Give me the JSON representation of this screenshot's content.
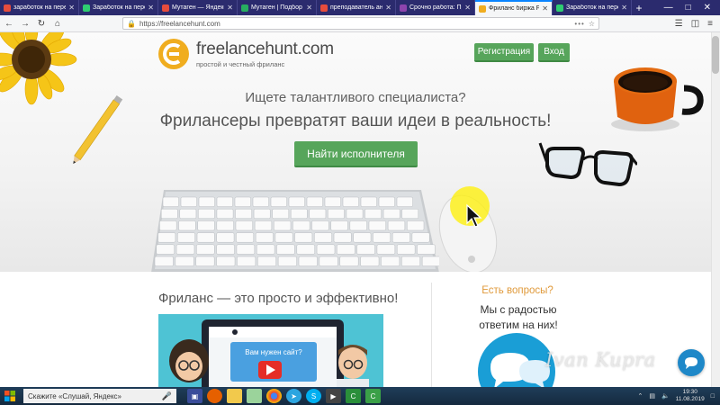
{
  "tabs": [
    {
      "title": "заработок на перев...",
      "favicon_color": "#e74c3c",
      "active": false
    },
    {
      "title": "Заработок на перево...",
      "favicon_color": "#2ecc71",
      "active": false
    },
    {
      "title": "Мутаген — Яндекс: н...",
      "favicon_color": "#e74c3c",
      "active": false
    },
    {
      "title": "Мутаген | Подбор кл...",
      "favicon_color": "#27ae60",
      "active": false
    },
    {
      "title": "преподаватель англ...",
      "favicon_color": "#e74c3c",
      "active": false
    },
    {
      "title": "Срочно работа: Про...",
      "favicon_color": "#8e44ad",
      "active": false
    },
    {
      "title": "Фриланс биржа Free...",
      "favicon_color": "#f0ad1f",
      "active": true
    },
    {
      "title": "Заработок на перев...",
      "favicon_color": "#2ecc71",
      "active": false
    }
  ],
  "browser": {
    "url": "https://freelancehunt.com",
    "new_tab": "+",
    "more": "•••"
  },
  "site": {
    "logo_name": "freelancehunt.com",
    "logo_tagline": "простой и честный фриланс",
    "register_label": "Регистрация",
    "login_label": "Вход",
    "hero_question": "Ищете талантливого специалиста?",
    "hero_headline": "Фрилансеры превратят ваши идеи в реальность!",
    "find_button": "Найти исполнителя",
    "section_title": "Фриланс — это просто и эффективно!",
    "questions_title": "Есть вопросы?",
    "questions_sub": "Мы с радостью ответим на них!",
    "video_caption": "Вам нужен сайт?"
  },
  "watermark": "Ivan Kupra",
  "taskbar": {
    "search_text": "Скажите «Слушай, Яндекс»",
    "time": "19:30",
    "date": "11.08.2019"
  },
  "colors": {
    "accent_green": "#57a55b",
    "logo_orange": "#f0ad1f",
    "question_orange": "#e09a3b",
    "tabstrip": "#2b2b6e"
  }
}
